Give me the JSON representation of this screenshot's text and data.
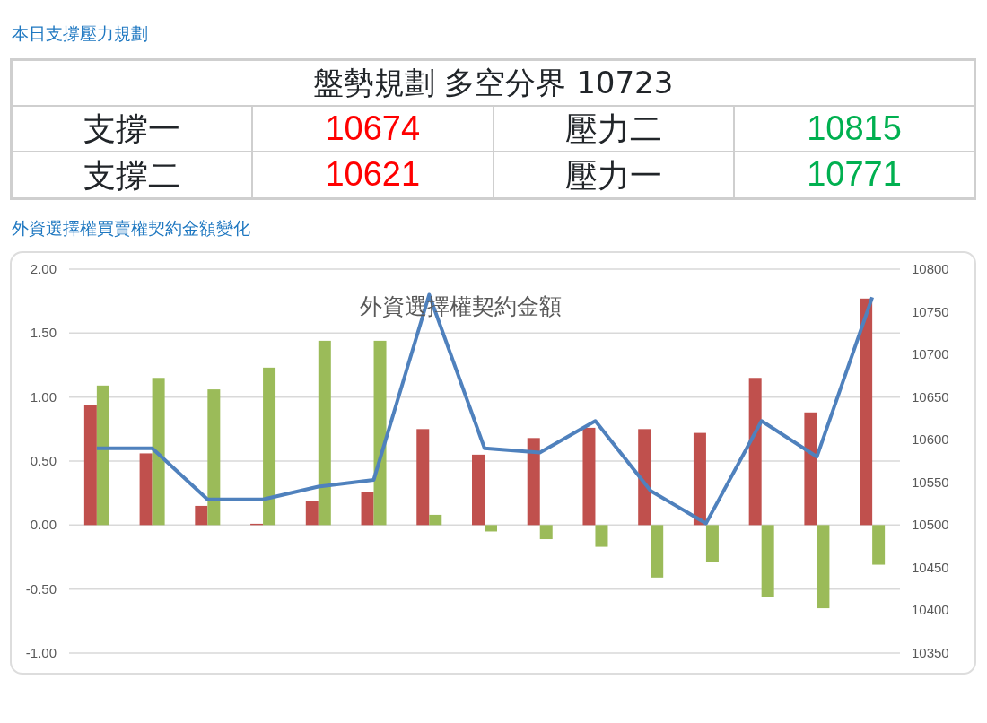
{
  "section_1_heading": "本日支撐壓力規劃",
  "plan_table": {
    "title": "盤勢規劃 多空分界 10723",
    "rows": [
      {
        "cells": [
          {
            "text": "支撐一"
          },
          {
            "text": "10674",
            "color": "#ff0000"
          },
          {
            "text": "壓力二"
          },
          {
            "text": "10815",
            "color": "#00b050"
          }
        ]
      },
      {
        "cells": [
          {
            "text": "支撐二"
          },
          {
            "text": "10621",
            "color": "#ff0000"
          },
          {
            "text": "壓力一"
          },
          {
            "text": "10771",
            "color": "#00b050"
          }
        ]
      }
    ]
  },
  "section_2_heading": "外資選擇權買賣權契約金額變化",
  "chart": {
    "chart_data": {
      "type": "bar",
      "title": "外資選擇權契約金額",
      "grid": true,
      "ylim": [
        -1,
        2
      ],
      "yticks": [
        {
          "value": -1,
          "label": "-1.00"
        },
        {
          "value": -0.5,
          "label": "-0.50"
        },
        {
          "value": 0,
          "label": "0.00"
        },
        {
          "value": 0.5,
          "label": "0.50"
        },
        {
          "value": 1,
          "label": "1.00"
        },
        {
          "value": 1.5,
          "label": "1.50"
        },
        {
          "value": 2,
          "label": "2.00"
        }
      ],
      "y2lim": [
        10350,
        10800
      ],
      "y2ticks": [
        10350,
        10400,
        10450,
        10500,
        10550,
        10600,
        10650,
        10700,
        10750,
        10800
      ],
      "series": [
        {
          "color": "#c0504d",
          "values": [
            0.94,
            0.56,
            0.15,
            0.01,
            0.19,
            0.26,
            0.75,
            0.55,
            0.68,
            0.76,
            0.75,
            0.72,
            1.15,
            0.88,
            1.77
          ]
        },
        {
          "color": "#9bbb59",
          "values": [
            1.09,
            1.15,
            1.06,
            1.23,
            1.44,
            1.44,
            0.08,
            -0.05,
            -0.11,
            -0.17,
            -0.41,
            -0.29,
            -0.56,
            -0.65,
            -0.31
          ]
        },
        {
          "color": "#4f81bd",
          "type": "line",
          "axis": "y2",
          "values": [
            10590,
            10590,
            10530,
            10530,
            10545,
            10553,
            10770,
            10590,
            10585,
            10622,
            10540,
            10502,
            10622,
            10580,
            10767
          ]
        }
      ]
    }
  }
}
